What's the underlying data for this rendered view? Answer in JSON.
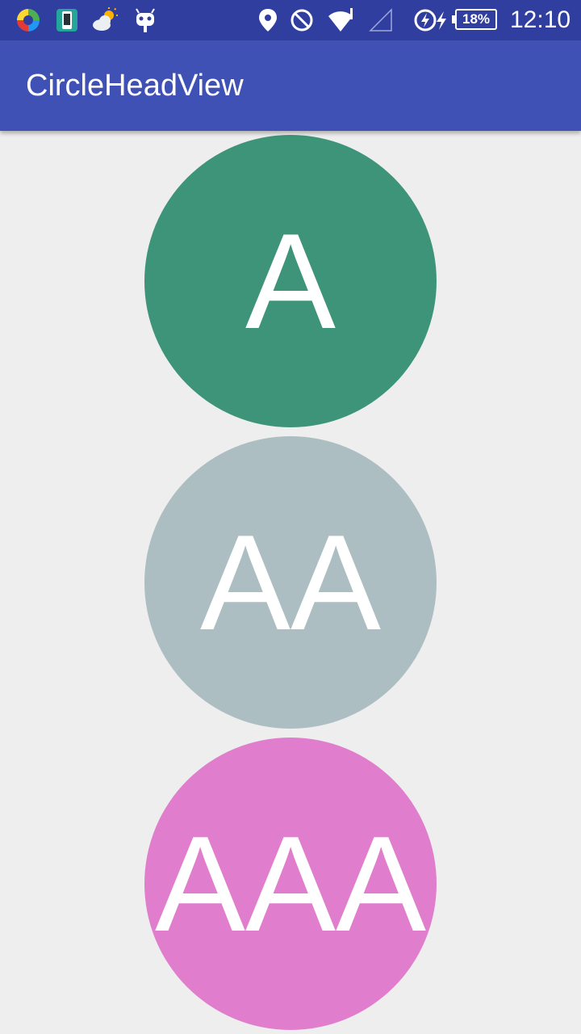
{
  "status_bar": {
    "icons": [
      "color-swirl-app-icon",
      "phone-app-icon",
      "weather-cloud-sun-icon",
      "android-bot-icon",
      "location-pin-icon",
      "do-not-disturb-icon",
      "wifi-icon",
      "signal-empty-icon",
      "battery-saver-icon",
      "charging-bolt-icon"
    ],
    "battery": "18%",
    "time": "12:10",
    "background_color": "#303f9f"
  },
  "app_bar": {
    "title": "CircleHeadView",
    "background_color": "#3f51b5"
  },
  "circle_heads": [
    {
      "text": "A",
      "color": "#3d9478"
    },
    {
      "text": "AA",
      "color": "#adbec3"
    },
    {
      "text": "AAA",
      "color": "#e07ecd"
    }
  ],
  "background_color": "#eeeeee"
}
